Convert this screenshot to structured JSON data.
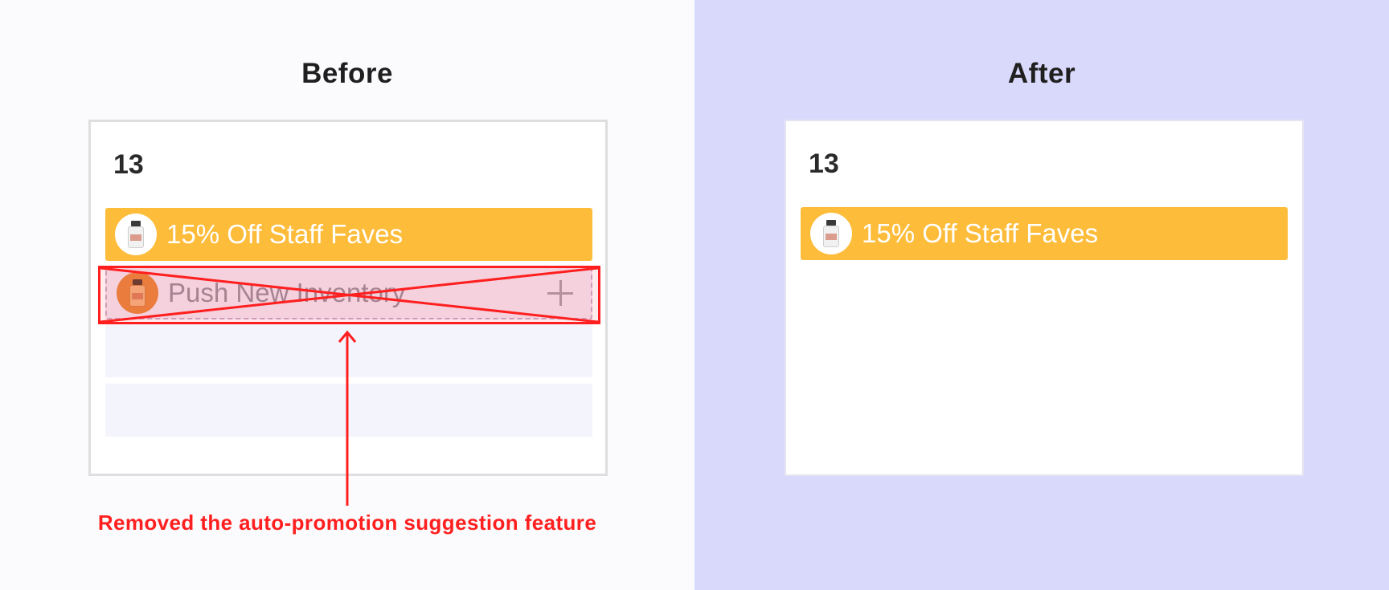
{
  "before": {
    "title": "Before",
    "day_number": "13",
    "promotions": [
      {
        "label": "15% Off Staff Faves",
        "state": "active",
        "color": "#fdbc3a",
        "icon": "product-bottle-icon"
      },
      {
        "label": "Push New Inventory",
        "state": "suggested-removed",
        "icon": "product-bottle-icon",
        "action_icon": "plus-icon"
      }
    ],
    "empty_slots": 2,
    "annotation": "Removed the auto-promotion suggestion feature",
    "annotation_color": "#ff1f1f"
  },
  "after": {
    "title": "After",
    "day_number": "13",
    "promotions": [
      {
        "label": "15% Off Staff Faves",
        "state": "active",
        "color": "#fdbc3a",
        "icon": "product-bottle-icon"
      }
    ],
    "background_color": "#d9d9fb"
  }
}
